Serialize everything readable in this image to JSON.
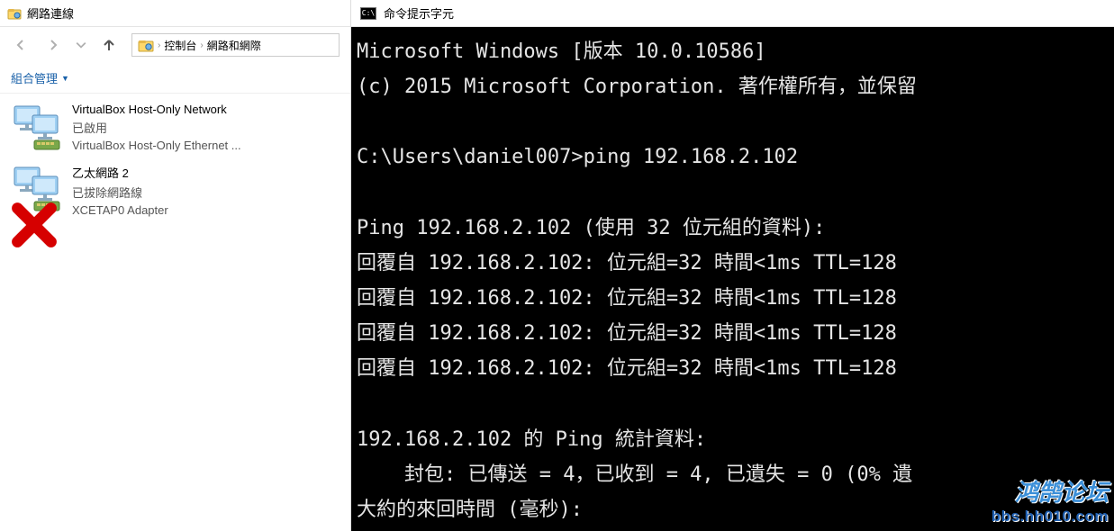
{
  "explorer": {
    "title": "網路連線",
    "breadcrumb": [
      "控制台",
      "網路和網際"
    ],
    "toolbar": {
      "organize": "組合管理"
    },
    "adapters": [
      {
        "name": "VirtualBox Host-Only Network",
        "status": "已啟用",
        "device": "VirtualBox Host-Only Ethernet ...",
        "error": false
      },
      {
        "name": "乙太網路 2",
        "status": "已拔除網路線",
        "device": "XCETAP0 Adapter",
        "error": true
      }
    ]
  },
  "cmd": {
    "title": "命令提示字元",
    "lines": [
      "Microsoft Windows [版本 10.0.10586]",
      "(c) 2015 Microsoft Corporation. 著作權所有，並保留",
      "",
      "C:\\Users\\daniel007>ping 192.168.2.102",
      "",
      "Ping 192.168.2.102 (使用 32 位元組的資料):",
      "回覆自 192.168.2.102: 位元組=32 時間<1ms TTL=128",
      "回覆自 192.168.2.102: 位元組=32 時間<1ms TTL=128",
      "回覆自 192.168.2.102: 位元組=32 時間<1ms TTL=128",
      "回覆自 192.168.2.102: 位元組=32 時間<1ms TTL=128",
      "",
      "192.168.2.102 的 Ping 統計資料:",
      "    封包: 已傳送 = 4，已收到 = 4, 已遺失 = 0 (0% 遺",
      "大約的來回時間 (毫秒):"
    ]
  },
  "watermark": {
    "line1": "鸿鹄论坛",
    "line2": "bbs.hh010.com"
  }
}
